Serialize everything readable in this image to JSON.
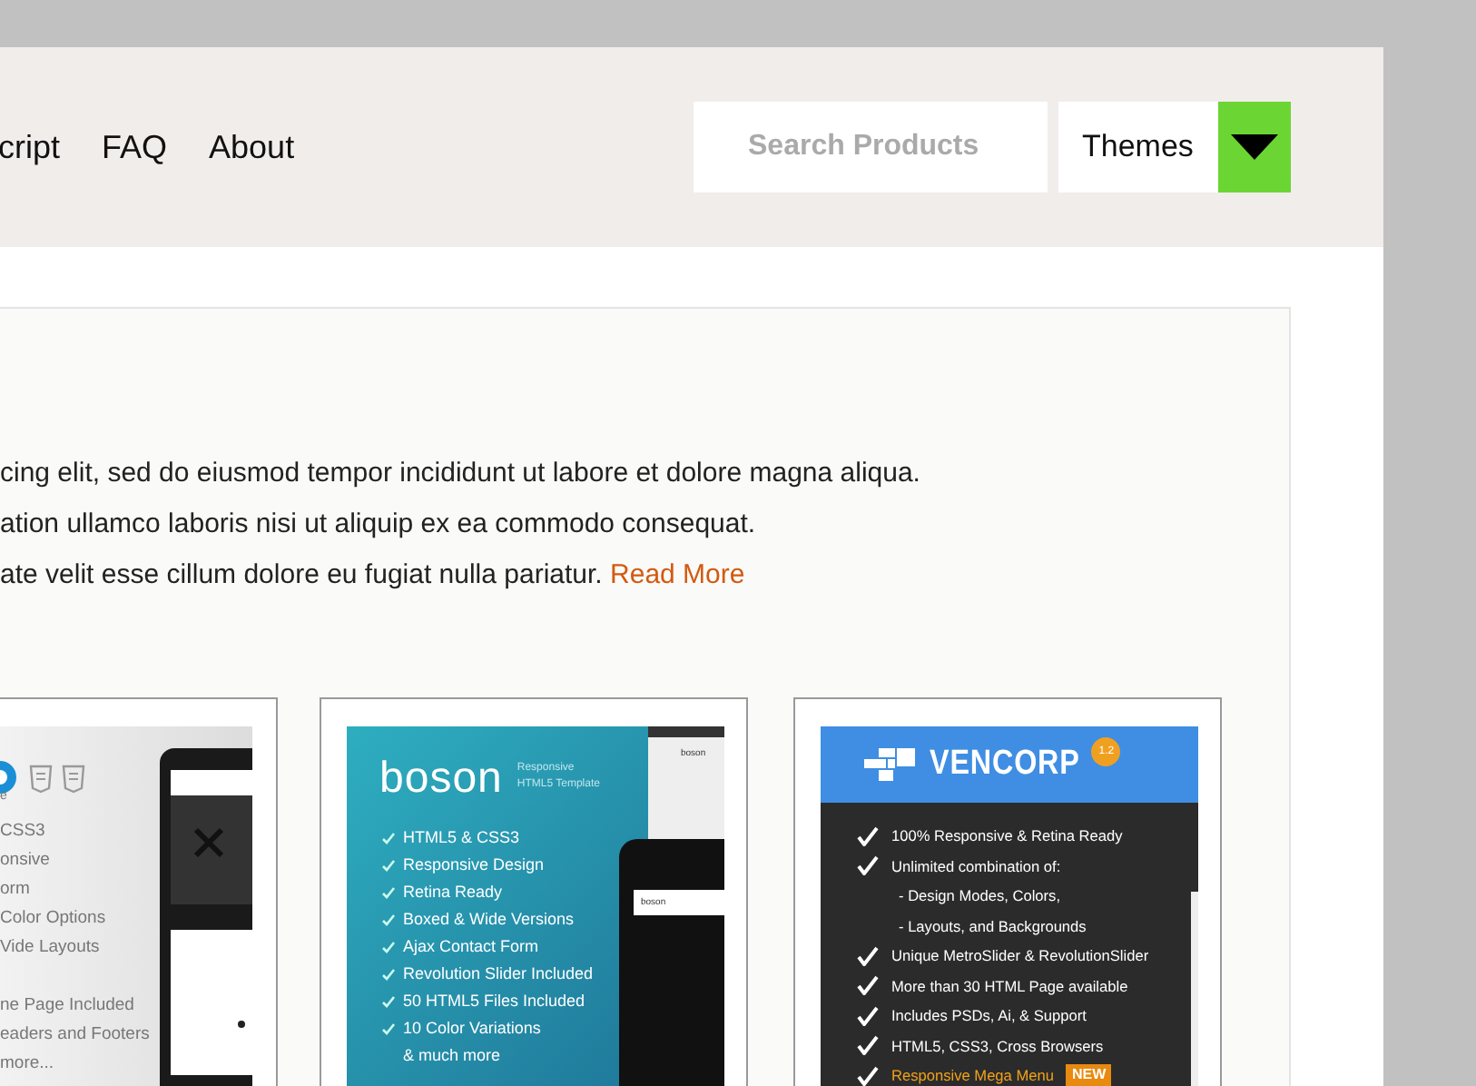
{
  "nav": {
    "links": [
      "cript",
      "FAQ",
      "About"
    ]
  },
  "search": {
    "placeholder": "Search Products"
  },
  "themes_dropdown": {
    "label": "Themes"
  },
  "intro": {
    "lines": [
      "cing elit, sed do eiusmod tempor incididunt ut labore et dolore magna aliqua.",
      "ation ullamco laboris nisi ut aliquip ex ea commodo consequat.",
      "ate velit esse cillum dolore eu fugiat nulla pariatur."
    ],
    "link": "Read More"
  },
  "products": [
    {
      "kind": "light",
      "logo_fragment": "e",
      "features": [
        "CSS3",
        "onsive",
        "orm",
        "Color Options",
        "Vide Layouts",
        "ne Page Included",
        "eaders and Footers",
        "more..."
      ]
    },
    {
      "kind": "boson",
      "logo": "boson",
      "tagline": [
        "Responsive",
        "HTML5 Template"
      ],
      "device_labels": [
        "boson",
        "boson"
      ],
      "features": [
        {
          "kind": "check",
          "text": "HTML5 & CSS3"
        },
        {
          "kind": "check",
          "text": "Responsive Design"
        },
        {
          "kind": "check",
          "text": "Retina Ready"
        },
        {
          "kind": "check",
          "text": "Boxed & Wide Versions"
        },
        {
          "kind": "check",
          "text": "Ajax Contact Form"
        },
        {
          "kind": "check",
          "text": "Revolution Slider Included"
        },
        {
          "kind": "check",
          "text": "50 HTML5 Files Included"
        },
        {
          "kind": "check",
          "text": "10 Color Variations"
        },
        {
          "kind": "plain",
          "text": "& much more"
        }
      ]
    },
    {
      "kind": "vencorp",
      "logo": "VENCORP",
      "version": "1.2",
      "features": [
        {
          "kind": "check",
          "text": "100% Responsive & Retina Ready"
        },
        {
          "kind": "check",
          "text": "Unlimited combination of:"
        },
        {
          "kind": "sub",
          "text": "- Design Modes, Colors,"
        },
        {
          "kind": "sub",
          "text": "- Layouts, and Backgrounds"
        },
        {
          "kind": "check",
          "text": "Unique MetroSlider & RevolutionSlider"
        },
        {
          "kind": "check",
          "text": "More than 30 HTML Page available"
        },
        {
          "kind": "check",
          "text": "Includes PSDs, Ai, & Support"
        },
        {
          "kind": "check",
          "text": "HTML5, CSS3, Cross Browsers"
        },
        {
          "kind": "highlight",
          "text": "Responsive Mega Menu",
          "badge": "NEW"
        }
      ]
    }
  ]
}
